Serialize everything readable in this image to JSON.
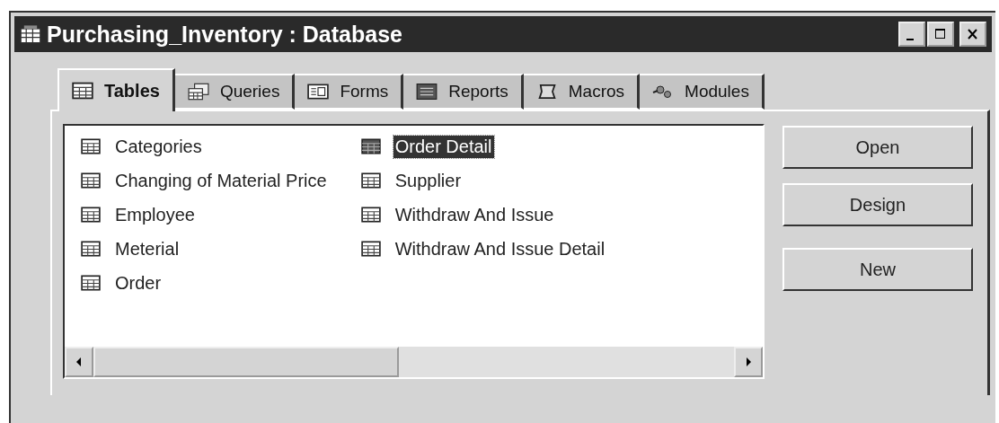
{
  "window": {
    "title": "Purchasing_Inventory : Database"
  },
  "tabs": [
    {
      "label": "Tables",
      "kind": "table",
      "selected": true
    },
    {
      "label": "Queries",
      "kind": "query",
      "selected": false
    },
    {
      "label": "Forms",
      "kind": "form",
      "selected": false
    },
    {
      "label": "Reports",
      "kind": "report",
      "selected": false
    },
    {
      "label": "Macros",
      "kind": "macro",
      "selected": false
    },
    {
      "label": "Modules",
      "kind": "module",
      "selected": false
    }
  ],
  "items": [
    {
      "label": "Categories",
      "selected": false
    },
    {
      "label": "Changing of Material Price",
      "selected": false
    },
    {
      "label": "Employee",
      "selected": false
    },
    {
      "label": "Meterial",
      "selected": false
    },
    {
      "label": "Order",
      "selected": false
    },
    {
      "label": "Order Detail",
      "selected": true
    },
    {
      "label": "Supplier",
      "selected": false
    },
    {
      "label": "Withdraw And Issue",
      "selected": false
    },
    {
      "label": "Withdraw And Issue Detail",
      "selected": false
    }
  ],
  "buttons": [
    "Open",
    "Design",
    "New"
  ]
}
